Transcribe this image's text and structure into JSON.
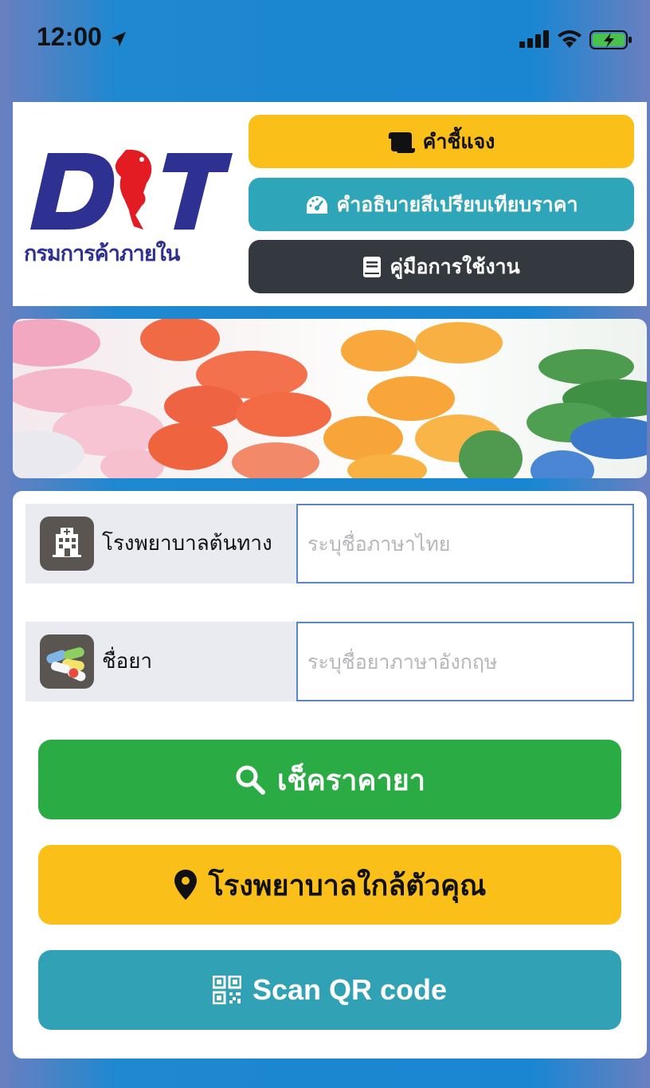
{
  "status_bar": {
    "time": "12:00"
  },
  "header": {
    "logo_sub": "กรมการค้าภายใน",
    "buttons": [
      {
        "label": "คำชี้แจง",
        "icon": "scroll-icon"
      },
      {
        "label": "คำอธิบายสีเปรียบเทียบราคา",
        "icon": "speedometer-icon"
      },
      {
        "label": "คู่มือการใช้งาน",
        "icon": "book-icon"
      }
    ]
  },
  "form": {
    "hospital": {
      "label": "โรงพยาบาลต้นทาง",
      "placeholder": "ระบุชื่อภาษาไทย",
      "value": "",
      "icon": "hospital-icon"
    },
    "drug": {
      "label": "ชื่อยา",
      "placeholder": "ระบุชื่อยาภาษาอังกฤษ",
      "value": "",
      "icon": "pills-icon"
    }
  },
  "actions": {
    "check_price": "เช็คราคายา",
    "nearby_hospital": "โรงพยาบาลใกล้ตัวคุณ",
    "scan_qr": "Scan QR code"
  },
  "colors": {
    "yellow": "#fbbf1a",
    "teal": "#2ea5b8",
    "dark": "#33393e",
    "green": "#2aab43",
    "input_border": "#5b84c4",
    "logo_blue": "#2e3192",
    "logo_red": "#e31b23"
  }
}
